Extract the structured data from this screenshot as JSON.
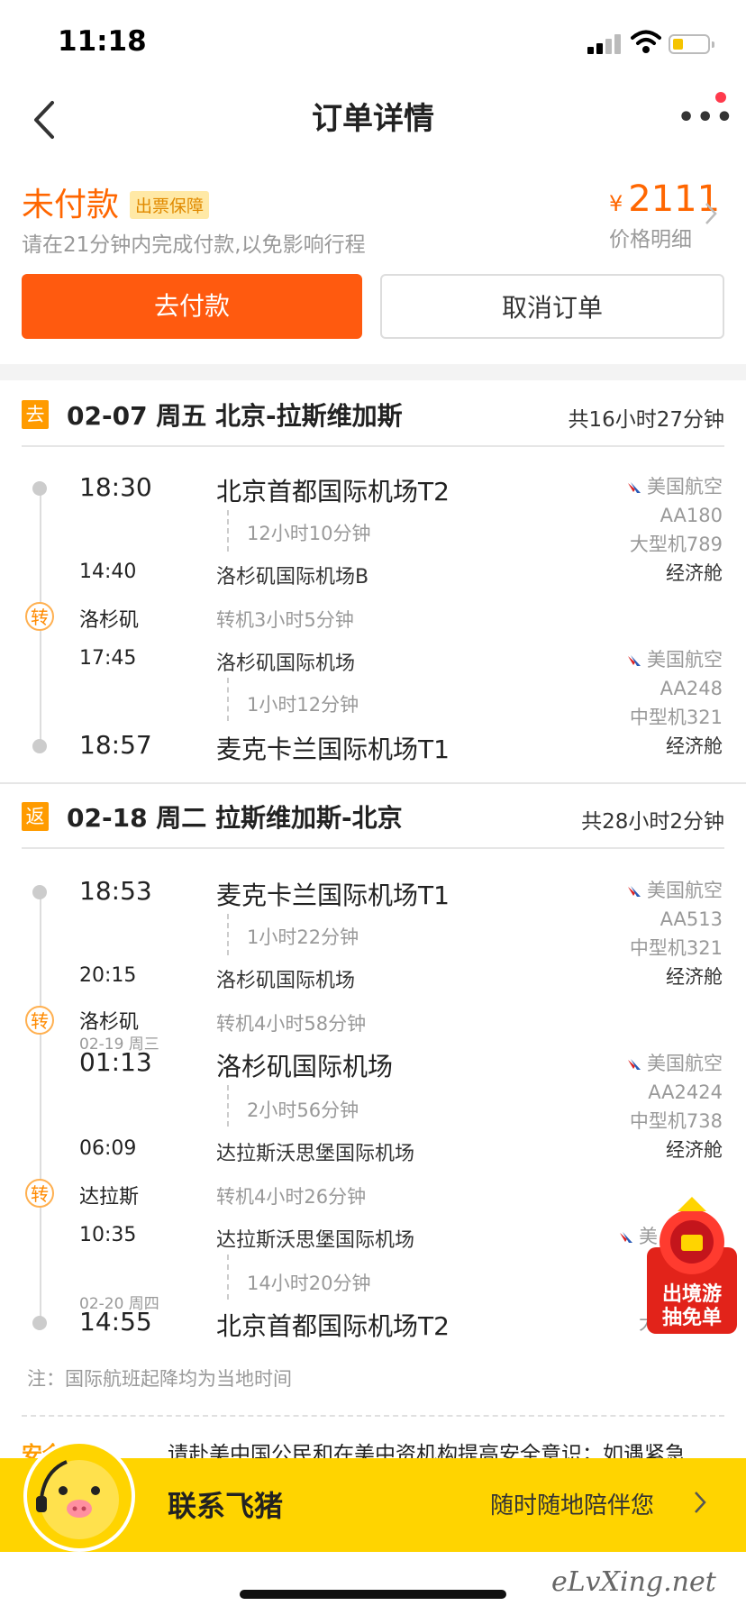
{
  "status_bar": {
    "time": "11:18"
  },
  "nav": {
    "title": "订单详情"
  },
  "order": {
    "status": "未付款",
    "tag": "出票保障",
    "note": "请在21分钟内完成付款,以免影响行程",
    "currency": "¥",
    "price": "2111",
    "price_detail": "价格明细",
    "pay_label": "去付款",
    "cancel_label": "取消订单"
  },
  "outbound": {
    "badge": "去",
    "title": "02-07 周五 北京-拉斯维加斯",
    "total": "共16小时27分钟",
    "legs": [
      {
        "dep_time": "18:30",
        "dep_airport": "北京首都国际机场T2",
        "duration": "12小时10分钟",
        "arr_time": "14:40",
        "arr_airport": "洛杉矶国际机场B",
        "airline": "美国航空",
        "flight": "AA180",
        "aircraft": "大型机789",
        "cabin": "经济舱"
      },
      {
        "dep_time": "17:45",
        "dep_airport": "洛杉矶国际机场",
        "duration": "1小时12分钟",
        "arr_time": "18:57",
        "arr_airport": "麦克卡兰国际机场T1",
        "airline": "美国航空",
        "flight": "AA248",
        "aircraft": "中型机321",
        "cabin": "经济舱"
      }
    ],
    "transfers": [
      {
        "badge": "转",
        "city": "洛杉矶",
        "text": "转机3小时5分钟"
      }
    ]
  },
  "return": {
    "badge": "返",
    "title": "02-18 周二 拉斯维加斯-北京",
    "total": "共28小时2分钟",
    "legs": [
      {
        "dep_time": "18:53",
        "dep_airport": "麦克卡兰国际机场T1",
        "duration": "1小时22分钟",
        "arr_time": "20:15",
        "arr_airport": "洛杉矶国际机场",
        "airline": "美国航空",
        "flight": "AA513",
        "aircraft": "中型机321",
        "cabin": "经济舱"
      },
      {
        "dep_date": "02-19 周三",
        "dep_time": "01:13",
        "dep_airport": "洛杉矶国际机场",
        "duration": "2小时56分钟",
        "arr_time": "06:09",
        "arr_airport": "达拉斯沃思堡国际机场",
        "airline": "美国航空",
        "flight": "AA2424",
        "aircraft": "中型机738",
        "cabin": "经济舱"
      },
      {
        "dep_time": "10:35",
        "dep_airport": "达拉斯沃思堡国际机场",
        "duration": "14小时20分钟",
        "arr_date": "02-20 周四",
        "arr_time": "14:55",
        "arr_airport": "北京首都国际机场T2",
        "airline_partial": "美",
        "aircraft_partial": "大"
      }
    ],
    "transfers": [
      {
        "badge": "转",
        "city": "洛杉矶",
        "text": "转机4小时58分钟"
      },
      {
        "badge": "转",
        "city": "达拉斯",
        "text": "转机4小时26分钟"
      }
    ]
  },
  "footnote": "注：国际航班起降均为当地时间",
  "safety": {
    "heading": "安全",
    "text": "请赴美中国公民和在美中资机构提高安全意识；如遇紧急"
  },
  "contact": {
    "label": "联系飞猪",
    "tagline": "随时随地陪伴您"
  },
  "promo": {
    "line1": "出境游",
    "line2": "抽免单"
  },
  "watermark": "eLvXing.net",
  "colors": {
    "accent": "#ff6600",
    "pay_button": "#ff5a0f",
    "badge": "#ff9b00",
    "contact_bar": "#ffd400"
  }
}
